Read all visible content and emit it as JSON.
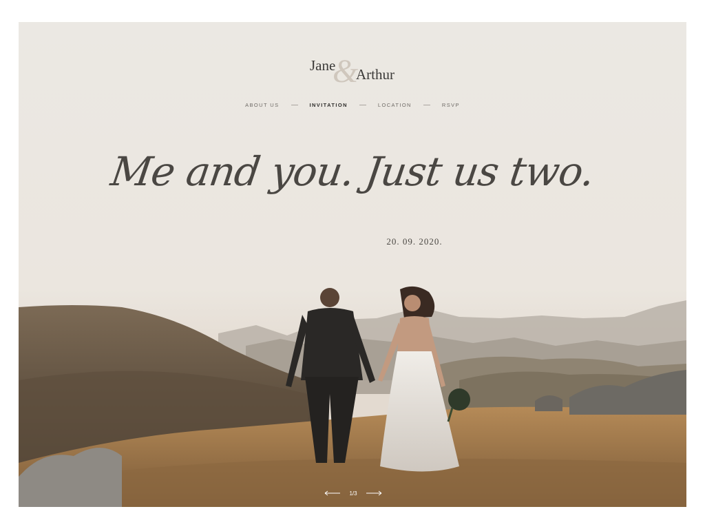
{
  "logo": {
    "first": "Jane",
    "ampersand": "&",
    "second": "Arthur"
  },
  "nav": {
    "items": [
      {
        "label": "ABOUT US",
        "active": false
      },
      {
        "label": "INVITATION",
        "active": true
      },
      {
        "label": "LOCATION",
        "active": false
      },
      {
        "label": "RSVP",
        "active": false
      }
    ]
  },
  "hero": {
    "headline": "Me and you. Just us two.",
    "date": "20. 09. 2020."
  },
  "slider": {
    "counter": "1/3"
  },
  "colors": {
    "sky": "#ebe7e1",
    "text": "#4a4743",
    "grass": "#a87e4f",
    "hills": "#6f5d49"
  },
  "icons": [
    "arrow-left-icon",
    "arrow-right-icon"
  ]
}
